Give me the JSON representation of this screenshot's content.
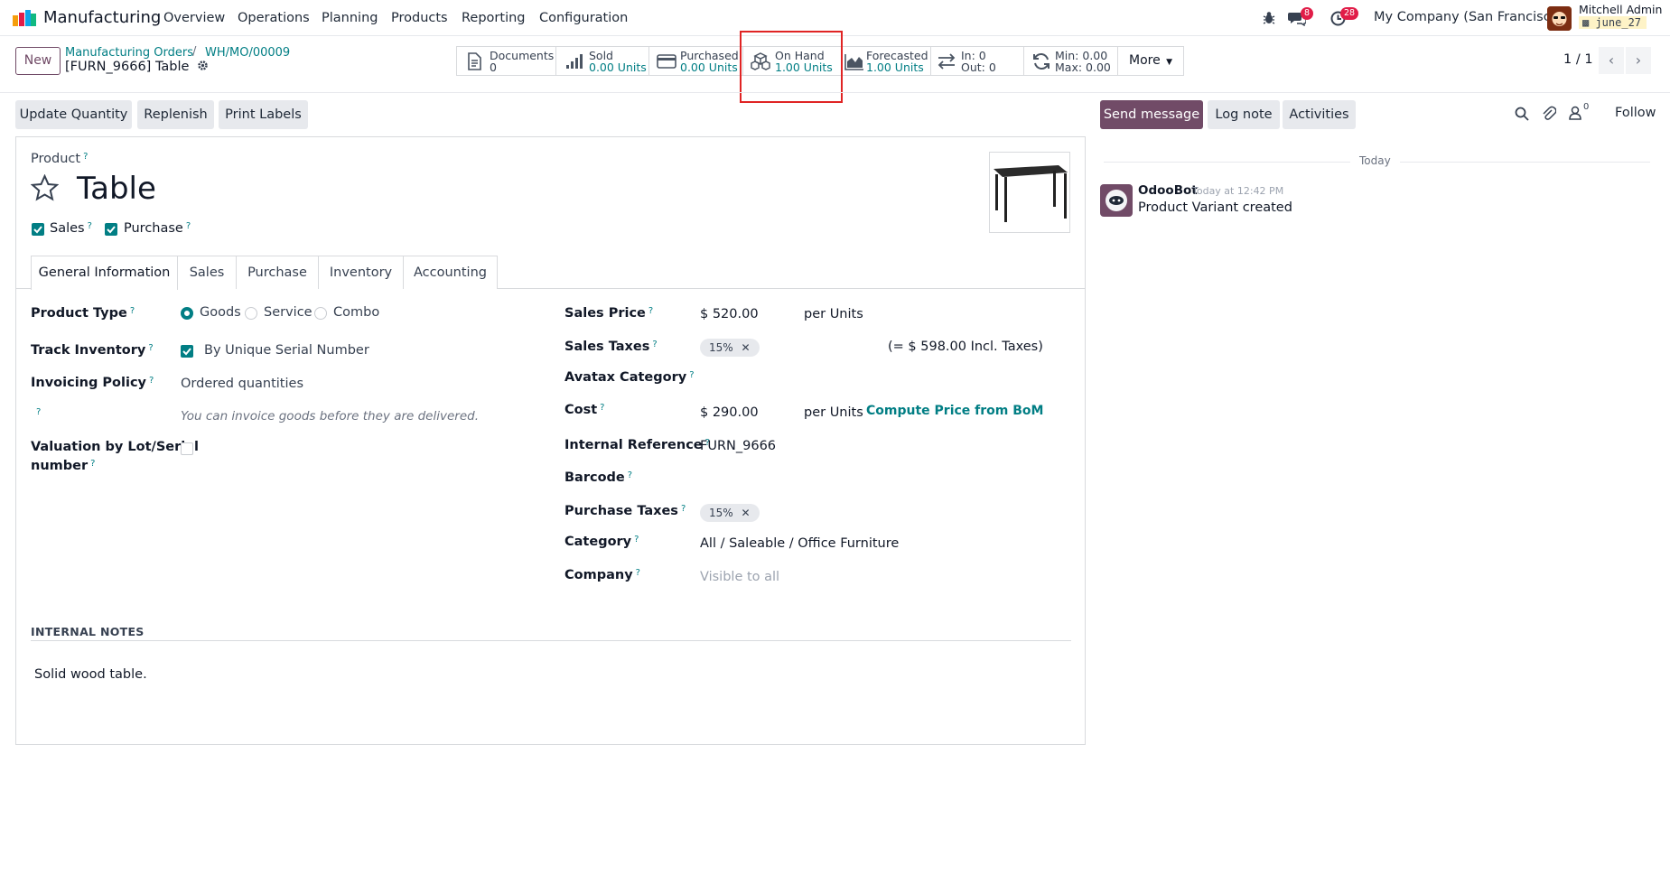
{
  "navbar": {
    "app_name": "Manufacturing",
    "menus": [
      "Overview",
      "Operations",
      "Planning",
      "Products",
      "Reporting",
      "Configuration"
    ],
    "messages_count": "8",
    "activities_count": "28",
    "company": "My Company (San Francisco)",
    "user_name": "Mitchell Admin",
    "database": "june_27"
  },
  "control": {
    "new_label": "New",
    "breadcrumb": [
      "Manufacturing Orders",
      "WH/MO/00009"
    ],
    "record_name": "[FURN_9666] Table",
    "pager": "1 / 1",
    "more_label": "More",
    "smart_buttons": [
      {
        "label": "Documents",
        "value": "0",
        "icon": "file-icon"
      },
      {
        "label": "Sold",
        "value": "0.00 Units",
        "icon": "signal-icon"
      },
      {
        "label": "Purchased",
        "value": "0.00 Units",
        "icon": "credit-card-icon"
      },
      {
        "label": "On Hand",
        "value": "1.00 Units",
        "icon": "cubes-icon"
      },
      {
        "label": "Forecasted",
        "value": "1.00 Units",
        "icon": "area-chart-icon"
      },
      {
        "label": "In: 0",
        "value": "Out: 0",
        "icon": "exchange-icon"
      },
      {
        "label": "Min: 0.00",
        "value": "Max: 0.00",
        "icon": "refresh-icon"
      }
    ]
  },
  "actions": {
    "update_quantity": "Update Quantity",
    "replenish": "Replenish",
    "print_labels": "Print Labels"
  },
  "form": {
    "product_label": "Product",
    "product_name": "Table",
    "sales_label": "Sales",
    "purchase_label": "Purchase",
    "tabs": [
      "General Information",
      "Sales",
      "Purchase",
      "Inventory",
      "Accounting"
    ],
    "product_type_label": "Product Type",
    "product_type_options": [
      "Goods",
      "Service",
      "Combo"
    ],
    "track_inventory_label": "Track Inventory",
    "track_inventory_value": "By Unique Serial Number",
    "invoicing_policy_label": "Invoicing Policy",
    "invoicing_policy_value": "Ordered quantities",
    "invoicing_hint": "You can invoice goods before they are delivered.",
    "valuation_label_1": "Valuation by Lot/Serial",
    "valuation_label_2": "number",
    "sales_price_label": "Sales Price",
    "sales_price_value": "$ 520.00",
    "per_units": "per Units",
    "sales_taxes_label": "Sales Taxes",
    "sales_tax_tag": "15%",
    "incl_taxes": "(= $ 598.00 Incl. Taxes)",
    "avatax_label": "Avatax Category",
    "cost_label": "Cost",
    "cost_value": "$ 290.00",
    "compute_price": "Compute Price from BoM",
    "internal_ref_label": "Internal Reference",
    "internal_ref_value": "FURN_9666",
    "barcode_label": "Barcode",
    "purchase_taxes_label": "Purchase Taxes",
    "purchase_tax_tag": "15%",
    "category_label": "Category",
    "category_value": "All / Saleable / Office Furniture",
    "company_label": "Company",
    "company_placeholder": "Visible to all",
    "internal_notes_title": "INTERNAL NOTES",
    "internal_notes_value": "Solid wood table."
  },
  "chatter": {
    "send_message": "Send message",
    "log_note": "Log note",
    "activities": "Activities",
    "followers_count": "0",
    "follow": "Follow",
    "date_separator": "Today",
    "author": "OdooBot",
    "time": "Today at 12:42 PM",
    "message": "Product Variant created"
  }
}
